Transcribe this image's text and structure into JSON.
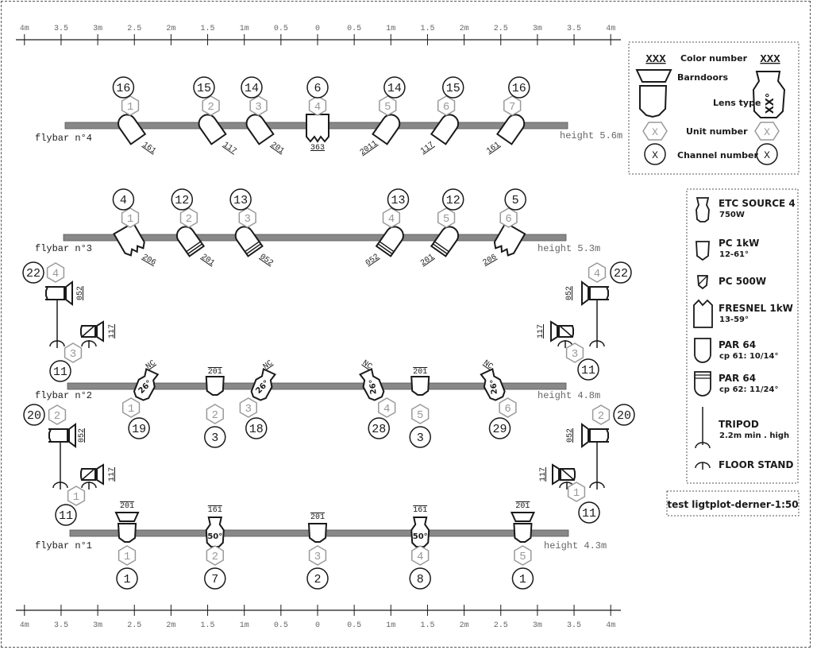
{
  "title": "test ligtplot-derner-1:50",
  "colors": {
    "bar": "#888888",
    "unit": "#999999",
    "ink": "#1a1a1a",
    "scale_text": "#666666"
  },
  "scale": {
    "labels": [
      "4m",
      "3.5",
      "3m",
      "2.5",
      "2m",
      "1.5",
      "1m",
      "0.5",
      "0",
      "0.5",
      "1m",
      "1.5",
      "2m",
      "2.5",
      "3m",
      "3.5",
      "4m"
    ],
    "values_m": [
      -4,
      -3.5,
      -3,
      -2.5,
      -2,
      -1.5,
      -1,
      -0.5,
      0,
      0.5,
      1,
      1.5,
      2,
      2.5,
      3,
      3.5,
      4
    ]
  },
  "legend_top": {
    "color_number_placeholder": "XXX",
    "color_number_label": "Color number",
    "barndoors_label": "Barndoors",
    "lens_type_label": "Lens type",
    "lens_placeholder": "XX°",
    "unit_number_label": "Unit  number",
    "unit_placeholder": "X",
    "channel_number_label": "Channel number",
    "channel_placeholder": "X"
  },
  "legend_fixtures": [
    {
      "type": "source4",
      "name": "ETC SOURCE 4",
      "detail": "750W"
    },
    {
      "type": "pc1k",
      "name": "PC 1kW",
      "detail": "12-61°"
    },
    {
      "type": "pc500",
      "name": "PC 500W",
      "detail": ""
    },
    {
      "type": "fresnel",
      "name": "FRESNEL 1kW",
      "detail": "13-59°"
    },
    {
      "type": "par61",
      "name": "PAR 64",
      "detail": "cp 61: 10/14°"
    },
    {
      "type": "par62",
      "name": "PAR 64",
      "detail": "cp 62: 11/24°"
    },
    {
      "type": "tripod",
      "name": "TRIPOD",
      "detail": "2.2m min . high"
    },
    {
      "type": "floorstand",
      "name": "FLOOR STAND",
      "detail": ""
    }
  ],
  "flybars": [
    {
      "name": "flybar n°4",
      "height": "height 5.6m",
      "fixtures": [
        {
          "type": "par61",
          "x_m": -2.55,
          "color": "161",
          "unit": "1",
          "channel": "16",
          "angle": -35
        },
        {
          "type": "par61",
          "x_m": -1.45,
          "color": "117",
          "unit": "2",
          "channel": "15",
          "angle": -35
        },
        {
          "type": "par61",
          "x_m": -0.8,
          "color": "201",
          "unit": "3",
          "channel": "14",
          "angle": -35
        },
        {
          "type": "fresnel",
          "x_m": 0,
          "color": "363",
          "unit": "4",
          "channel": "6",
          "angle": 0
        },
        {
          "type": "par61",
          "x_m": 0.95,
          "color": "2011",
          "unit": "5",
          "channel": "14",
          "angle": 35
        },
        {
          "type": "par61",
          "x_m": 1.75,
          "color": "117",
          "unit": "6",
          "channel": "15",
          "angle": 35
        },
        {
          "type": "par61",
          "x_m": 2.65,
          "color": "161",
          "unit": "7",
          "channel": "16",
          "angle": 35
        }
      ]
    },
    {
      "name": "flybar n°3",
      "height": "height 5.3m",
      "fixtures": [
        {
          "type": "fresnel",
          "x_m": -2.55,
          "color": "206",
          "unit": "1",
          "channel": "4",
          "angle": -30
        },
        {
          "type": "par62",
          "x_m": -1.75,
          "color": "201",
          "unit": "2",
          "channel": "12",
          "angle": -35
        },
        {
          "type": "par62",
          "x_m": -0.95,
          "color": "052",
          "unit": "3",
          "channel": "13",
          "angle": -35
        },
        {
          "type": "par62",
          "x_m": 1.0,
          "color": "052",
          "unit": "4",
          "channel": "13",
          "angle": 35
        },
        {
          "type": "par62",
          "x_m": 1.75,
          "color": "201",
          "unit": "5",
          "channel": "12",
          "angle": 35
        },
        {
          "type": "fresnel",
          "x_m": 2.6,
          "color": "206",
          "unit": "6",
          "channel": "5",
          "angle": 30
        }
      ]
    },
    {
      "name": "flybar n°2",
      "height": "height 4.8m",
      "fixtures": [
        {
          "type": "source4",
          "x_m": -2.35,
          "color": "NC",
          "lens": "26°",
          "unit": "1",
          "channel": "19",
          "angle": 25
        },
        {
          "type": "pc1k",
          "x_m": -1.4,
          "color": "201",
          "unit": "2",
          "channel": "3",
          "angle": 0
        },
        {
          "type": "source4",
          "x_m": -0.75,
          "color": "NC",
          "lens": "26°",
          "unit": "3",
          "channel": "18",
          "angle": 25
        },
        {
          "type": "source4",
          "x_m": 0.75,
          "color": "NC",
          "lens": "26°",
          "unit": "4",
          "channel": "28",
          "angle": -25
        },
        {
          "type": "pc1k",
          "x_m": 1.4,
          "color": "201",
          "unit": "5",
          "channel": "3",
          "angle": 0
        },
        {
          "type": "source4",
          "x_m": 2.4,
          "color": "NC",
          "lens": "26°",
          "unit": "6",
          "channel": "29",
          "angle": -25
        }
      ]
    },
    {
      "name": "flybar n°1",
      "height": "height 4.3m",
      "fixtures": [
        {
          "type": "pc1k_barn",
          "x_m": -2.6,
          "color": "201",
          "unit": "1",
          "channel": "1"
        },
        {
          "type": "source4",
          "x_m": -1.4,
          "color": "161",
          "lens": "50°",
          "unit": "2",
          "channel": "7"
        },
        {
          "type": "pc1k",
          "x_m": 0,
          "color": "201",
          "unit": "3",
          "channel": "2"
        },
        {
          "type": "source4",
          "x_m": 1.4,
          "color": "161",
          "lens": "50°",
          "unit": "4",
          "channel": "8"
        },
        {
          "type": "pc1k_barn",
          "x_m": 2.8,
          "color": "201",
          "unit": "5",
          "channel": "1"
        }
      ]
    }
  ],
  "side_booms": [
    {
      "side": "left",
      "level": "upper",
      "tripod": {
        "color": "052",
        "unit": "4",
        "channel": "22"
      },
      "floor": {
        "color": "117",
        "unit": "3",
        "channel": "11"
      }
    },
    {
      "side": "right",
      "level": "upper",
      "tripod": {
        "color": "052",
        "unit": "4",
        "channel": "22"
      },
      "floor": {
        "color": "117",
        "unit": "3",
        "channel": "11"
      }
    },
    {
      "side": "left",
      "level": "lower",
      "tripod": {
        "color": "052",
        "unit": "2",
        "channel": "20"
      },
      "floor": {
        "color": "117",
        "unit": "1",
        "channel": "11"
      }
    },
    {
      "side": "right",
      "level": "lower",
      "tripod": {
        "color": "052",
        "unit": "2",
        "channel": "20"
      },
      "floor": {
        "color": "117",
        "unit": "1",
        "channel": "11"
      }
    }
  ]
}
